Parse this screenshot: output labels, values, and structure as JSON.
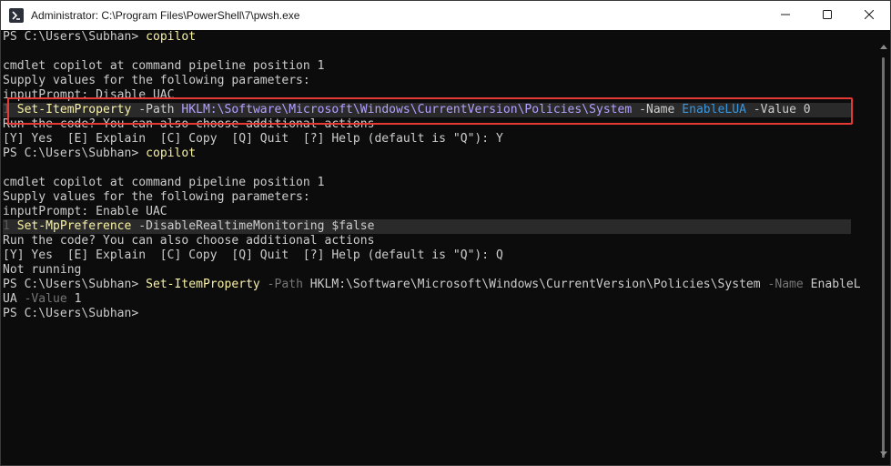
{
  "window": {
    "title": "Administrator: C:\\Program Files\\PowerShell\\7\\pwsh.exe",
    "icon": "powershell-icon",
    "controls": [
      "minimize-icon",
      "maximize-icon",
      "close-icon"
    ]
  },
  "colors": {
    "background": "#0c0c0c",
    "text": "#cccccc",
    "command": "#f9f1a5",
    "parameter": "#767676",
    "highlight_border": "#e53935"
  },
  "terminal": {
    "l1": {
      "prompt": "PS C:\\Users\\Subhan> ",
      "cmd": "copilot"
    },
    "l2": "",
    "l3": "cmdlet copilot at command pipeline position 1",
    "l4": "Supply values for the following parameters:",
    "l5": "inputPrompt: Disable UAC",
    "l6": {
      "num": "1 ",
      "cmd": "Set-ItemProperty",
      "p1": " -Path ",
      "path": "HKLM:\\Software\\Microsoft\\Windows\\CurrentVersion\\Policies\\System",
      "p2": " -Name ",
      "name": "EnableLUA",
      "p3": " -Value ",
      "value": "0"
    },
    "l7": "Run the code? You can also choose additional actions",
    "l8": "[Y] Yes  [E] Explain  [C] Copy  [Q] Quit  [?] Help (default is \"Q\"): Y",
    "l9": {
      "prompt": "PS C:\\Users\\Subhan> ",
      "cmd": "copilot"
    },
    "l10": "",
    "l11": "cmdlet copilot at command pipeline position 1",
    "l12": "Supply values for the following parameters:",
    "l13": "inputPrompt: Enable UAC",
    "l14": {
      "num": "1 ",
      "cmd": "Set-MpPreference",
      "p1": " -DisableRealtimeMonitoring ",
      "value": "$false"
    },
    "l15": "Run the code? You can also choose additional actions",
    "l16": "[Y] Yes  [E] Explain  [C] Copy  [Q] Quit  [?] Help (default is \"Q\"): Q",
    "l17": "Not running",
    "l18": {
      "prompt": "PS C:\\Users\\Subhan> ",
      "cmd": "Set-ItemProperty",
      "p1": " -Path ",
      "path": "HKLM:\\Software\\Microsoft\\Windows\\CurrentVersion\\Policies\\System",
      "p2": " -Name ",
      "name1": "EnableL"
    },
    "l19": {
      "name2": "UA",
      "p3": " -Value ",
      "value": "1"
    },
    "l20": {
      "prompt": "PS C:\\Users\\Subhan>"
    }
  }
}
